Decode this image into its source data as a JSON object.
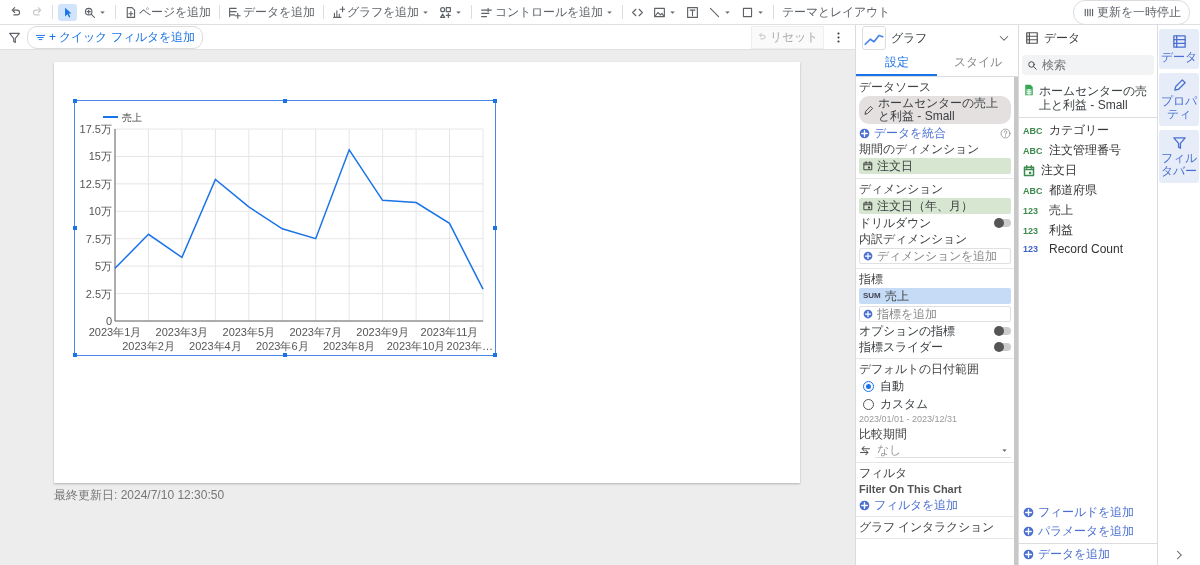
{
  "toolbar": {
    "select_tool_selected": true,
    "redo_disabled": true,
    "add_page": "ページを追加",
    "add_data": "データを追加",
    "add_chart": "グラフを追加",
    "add_control": "コントロールを追加",
    "theme": "テーマとレイアウト",
    "pause_update": "更新を一時停止"
  },
  "filter_bar": {
    "quick_filter": "+ クイック フィルタを追加",
    "reset": "リセット",
    "reset_disabled": true
  },
  "canvas": {
    "last_updated": "最終更新日: 2024/7/10 12:30:50",
    "chart": {
      "selected": true,
      "chart_data": {
        "type": "line",
        "grid": true,
        "categories": [
          "2023年1月",
          "2023年2月",
          "2023年3月",
          "2023年4月",
          "2023年5月",
          "2023年6月",
          "2023年7月",
          "2023年8月",
          "2023年9月",
          "2023年10月",
          "2023年11月",
          "2023年…"
        ],
        "series": [
          {
            "name": "売上",
            "color": "#1a73e8",
            "values": [
              4.8,
              7.9,
              5.8,
              12.9,
              10.4,
              8.4,
              7.5,
              15.6,
              11.0,
              10.8,
              8.9,
              2.9
            ]
          }
        ],
        "ylim": [
          0,
          17.5
        ],
        "yticks": [
          {
            "value": 0,
            "label": "0"
          },
          {
            "value": 2.5,
            "label": "2.5万"
          },
          {
            "value": 5,
            "label": "5万"
          },
          {
            "value": 7.5,
            "label": "7.5万"
          },
          {
            "value": 10,
            "label": "10万"
          },
          {
            "value": 12.5,
            "label": "12.5万"
          },
          {
            "value": 15,
            "label": "15万"
          },
          {
            "value": 17.5,
            "label": "17.5万"
          }
        ]
      }
    }
  },
  "properties": {
    "title": "グラフ",
    "tabs": [
      {
        "label": "設定",
        "selected": true
      },
      {
        "label": "スタイル",
        "selected": false
      }
    ],
    "sections": [
      {
        "rows": [
          {
            "kind": "heading",
            "text": "データソース"
          },
          {
            "kind": "source",
            "text": "ホームセンターの売上と利益 - Small"
          },
          {
            "kind": "add",
            "text": "データを統合",
            "help": true
          },
          {
            "kind": "heading",
            "text": "期間のディメンション"
          },
          {
            "kind": "dimension",
            "text": "注文日"
          }
        ]
      },
      {
        "rows": [
          {
            "kind": "heading",
            "text": "ディメンション"
          },
          {
            "kind": "dimension",
            "text": "注文日（年、月）"
          },
          {
            "kind": "toggle",
            "text": "ドリルダウン",
            "on": false
          },
          {
            "kind": "heading",
            "text": "内訳ディメンション"
          },
          {
            "kind": "add_field",
            "text": "ディメンションを追加"
          }
        ]
      },
      {
        "rows": [
          {
            "kind": "heading",
            "text": "指標"
          },
          {
            "kind": "metric",
            "badge": "SUM",
            "text": "売上"
          },
          {
            "kind": "add_field",
            "text": "指標を追加"
          },
          {
            "kind": "toggle",
            "text": "オプションの指標",
            "on": false
          },
          {
            "kind": "toggle",
            "text": "指標スライダー",
            "on": false
          }
        ]
      },
      {
        "rows": [
          {
            "kind": "heading",
            "text": "デフォルトの日付範囲"
          },
          {
            "kind": "radio",
            "text": "自動",
            "selected": true
          },
          {
            "kind": "radio",
            "text": "カスタム",
            "selected": false
          },
          {
            "kind": "note",
            "text": "2023/01/01 - 2023/12/31"
          },
          {
            "kind": "heading",
            "text": "比較期間"
          },
          {
            "kind": "select",
            "text": "なし"
          }
        ]
      },
      {
        "rows": [
          {
            "kind": "heading",
            "text": "フィルタ"
          },
          {
            "kind": "subheading",
            "text": "Filter On This Chart"
          },
          {
            "kind": "add",
            "text": "フィルタを追加",
            "help": false
          }
        ]
      },
      {
        "rows": [
          {
            "kind": "heading",
            "text": "グラフ インタラクション"
          }
        ]
      }
    ]
  },
  "data_panel": {
    "title": "データ",
    "search": {
      "placeholder": "検索"
    },
    "source": "ホームセンターの売上と利益 - Small",
    "fields": [
      {
        "kind": "text",
        "type": "ABC",
        "name": "カテゴリー",
        "color": "#3d8a4f"
      },
      {
        "kind": "text",
        "type": "ABC",
        "name": "注文管理番号",
        "color": "#3d8a4f"
      },
      {
        "kind": "date",
        "name": "注文日",
        "color": "#3d8a4f"
      },
      {
        "kind": "text",
        "type": "ABC",
        "name": "都道府県",
        "color": "#3d8a4f"
      },
      {
        "kind": "number",
        "type": "123",
        "name": "売上",
        "color": "#3d8a4f"
      },
      {
        "kind": "number",
        "type": "123",
        "name": "利益",
        "color": "#3d8a4f"
      },
      {
        "kind": "number",
        "type": "123",
        "name": "Record Count",
        "color": "#3b63c9"
      }
    ],
    "add_links": [
      "フィールドを追加",
      "パラメータを追加"
    ],
    "add_data": "データを追加"
  },
  "rail": [
    "データ",
    "プロパティ",
    "フィルタバー"
  ]
}
